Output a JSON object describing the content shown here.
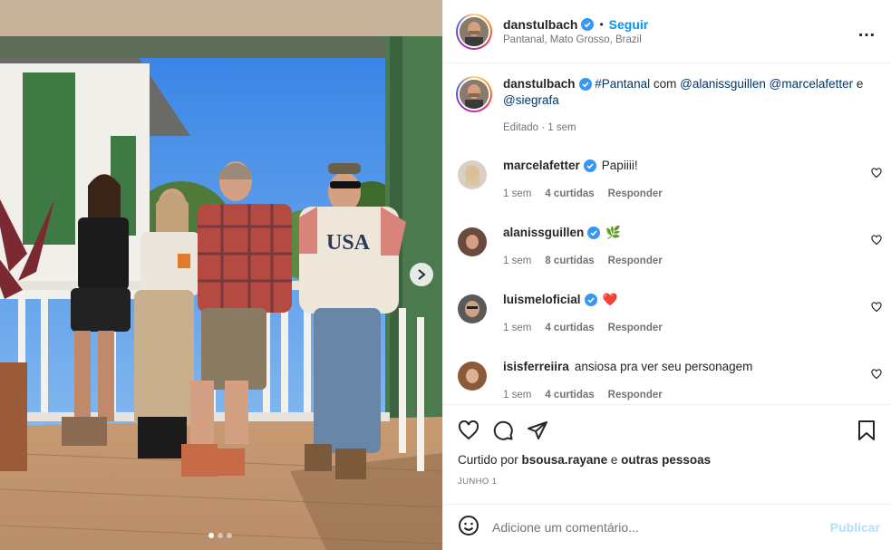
{
  "post": {
    "username": "danstulbach",
    "follow_label": "Seguir",
    "separator": "•",
    "location": "Pantanal, Mato Grosso, Brazil",
    "more_icon": "…"
  },
  "caption": {
    "username": "danstulbach",
    "hashtag": "#Pantanal",
    "text_mid": " com ",
    "mention1": "@alanissguillen",
    "mention2": "@marcelafetter",
    "text_and": " e ",
    "mention3": "@siegrafa",
    "meta": "Editado · 1 sem"
  },
  "comments": [
    {
      "username": "marcelafetter",
      "text": "Papiiii!",
      "age": "1 sem",
      "likes": "4 curtidas",
      "reply": "Responder",
      "avatar_color": "#d9cfc4"
    },
    {
      "username": "alanissguillen",
      "text": "🌿",
      "age": "1 sem",
      "likes": "8 curtidas",
      "reply": "Responder",
      "avatar_color": "#6a4a3a"
    },
    {
      "username": "luismeloficial",
      "text": "❤️",
      "age": "1 sem",
      "likes": "4 curtidas",
      "reply": "Responder",
      "avatar_color": "#5a5a5a"
    },
    {
      "username": "isisferreiira",
      "text": "ansiosa pra ver seu personagem",
      "age": "1 sem",
      "likes": "4 curtidas",
      "reply": "Responder",
      "avatar_color": "#8a5a3a"
    }
  ],
  "actions": {
    "liked_by_prefix": "Curtido por ",
    "liked_by_user": "bsousa.rayane",
    "liked_by_mid": " e ",
    "liked_by_rest": "outras pessoas",
    "date": "JUNHO 1"
  },
  "add_comment": {
    "placeholder": "Adicione um comentário...",
    "post_label": "Publicar"
  },
  "colors": {
    "accent": "#0095f6",
    "link": "#00376b",
    "muted": "#737373",
    "verified": "#3897f0",
    "post_disabled": "#b2dffc"
  },
  "icons": [
    "verified-badge-icon",
    "more-options-icon",
    "heart-icon",
    "comment-icon",
    "share-icon",
    "bookmark-icon",
    "emoji-icon",
    "chevron-right-icon"
  ]
}
